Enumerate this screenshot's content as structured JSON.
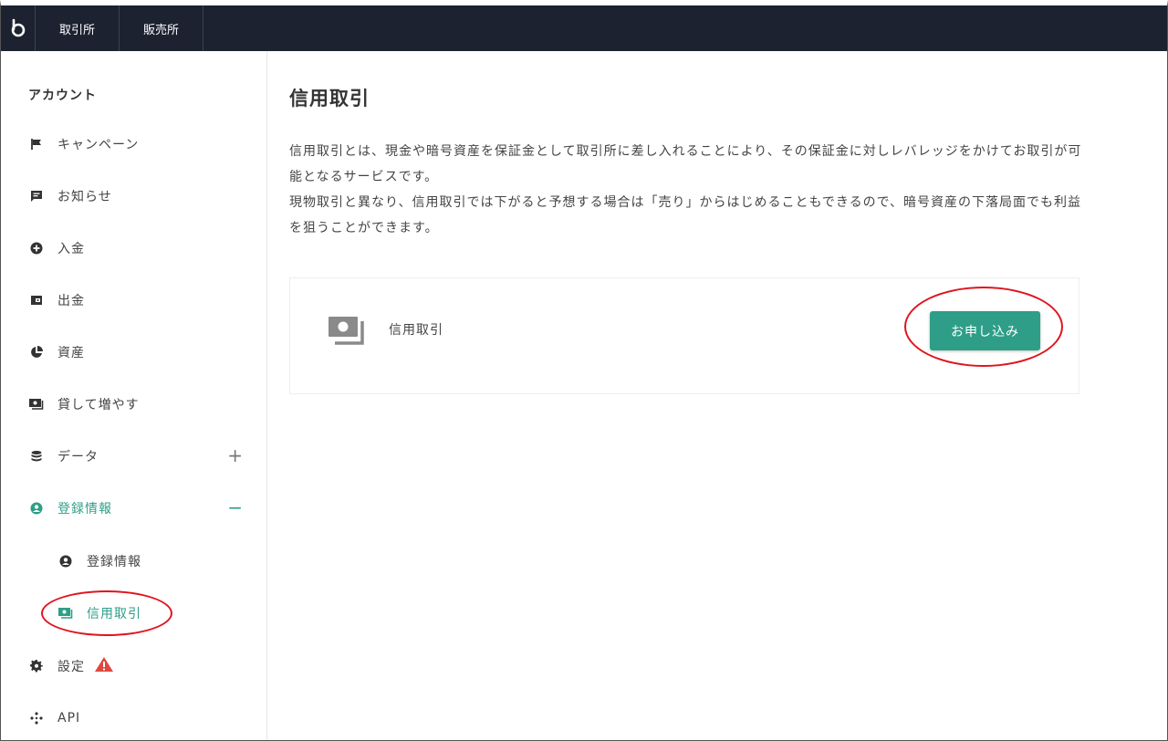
{
  "topnav": {
    "logo_icon": "bitbank-logo-icon",
    "items": [
      {
        "label": "取引所"
      },
      {
        "label": "販売所"
      }
    ]
  },
  "sidebar": {
    "title": "アカウント",
    "items": [
      {
        "label": "キャンペーン",
        "icon": "flag-icon"
      },
      {
        "label": "お知らせ",
        "icon": "message-icon"
      },
      {
        "label": "入金",
        "icon": "plus-circle-icon"
      },
      {
        "label": "出金",
        "icon": "wallet-icon"
      },
      {
        "label": "資産",
        "icon": "pie-chart-icon"
      },
      {
        "label": "貸して増やす",
        "icon": "cash-icon"
      },
      {
        "label": "データ",
        "icon": "database-icon",
        "toggle": "+"
      },
      {
        "label": "登録情報",
        "icon": "user-circle-icon",
        "toggle": "−",
        "active": true
      },
      {
        "label": "登録情報",
        "icon": "user-circle-icon",
        "sub": true
      },
      {
        "label": "信用取引",
        "icon": "cash-icon",
        "sub": true,
        "active": true
      },
      {
        "label": "設定",
        "icon": "gear-icon",
        "warning": true
      },
      {
        "label": "API",
        "icon": "api-icon"
      }
    ]
  },
  "main": {
    "title": "信用取引",
    "description_lines": [
      "信用取引とは、現金や暗号資産を保証金として取引所に差し入れることにより、その保証金に対しレバレッジをかけてお取引が可能となるサービスです。",
      "現物取引と異なり、信用取引では下がると予想する場合は「売り」からはじめることもできるので、暗号資産の下落局面でも利益を狙うことができます。"
    ],
    "card": {
      "label": "信用取引",
      "button_label": "お申し込み"
    }
  },
  "colors": {
    "accent": "#2e9e88",
    "topbar": "#1c2230",
    "highlight": "#e0141e",
    "warning": "#e0473e"
  }
}
